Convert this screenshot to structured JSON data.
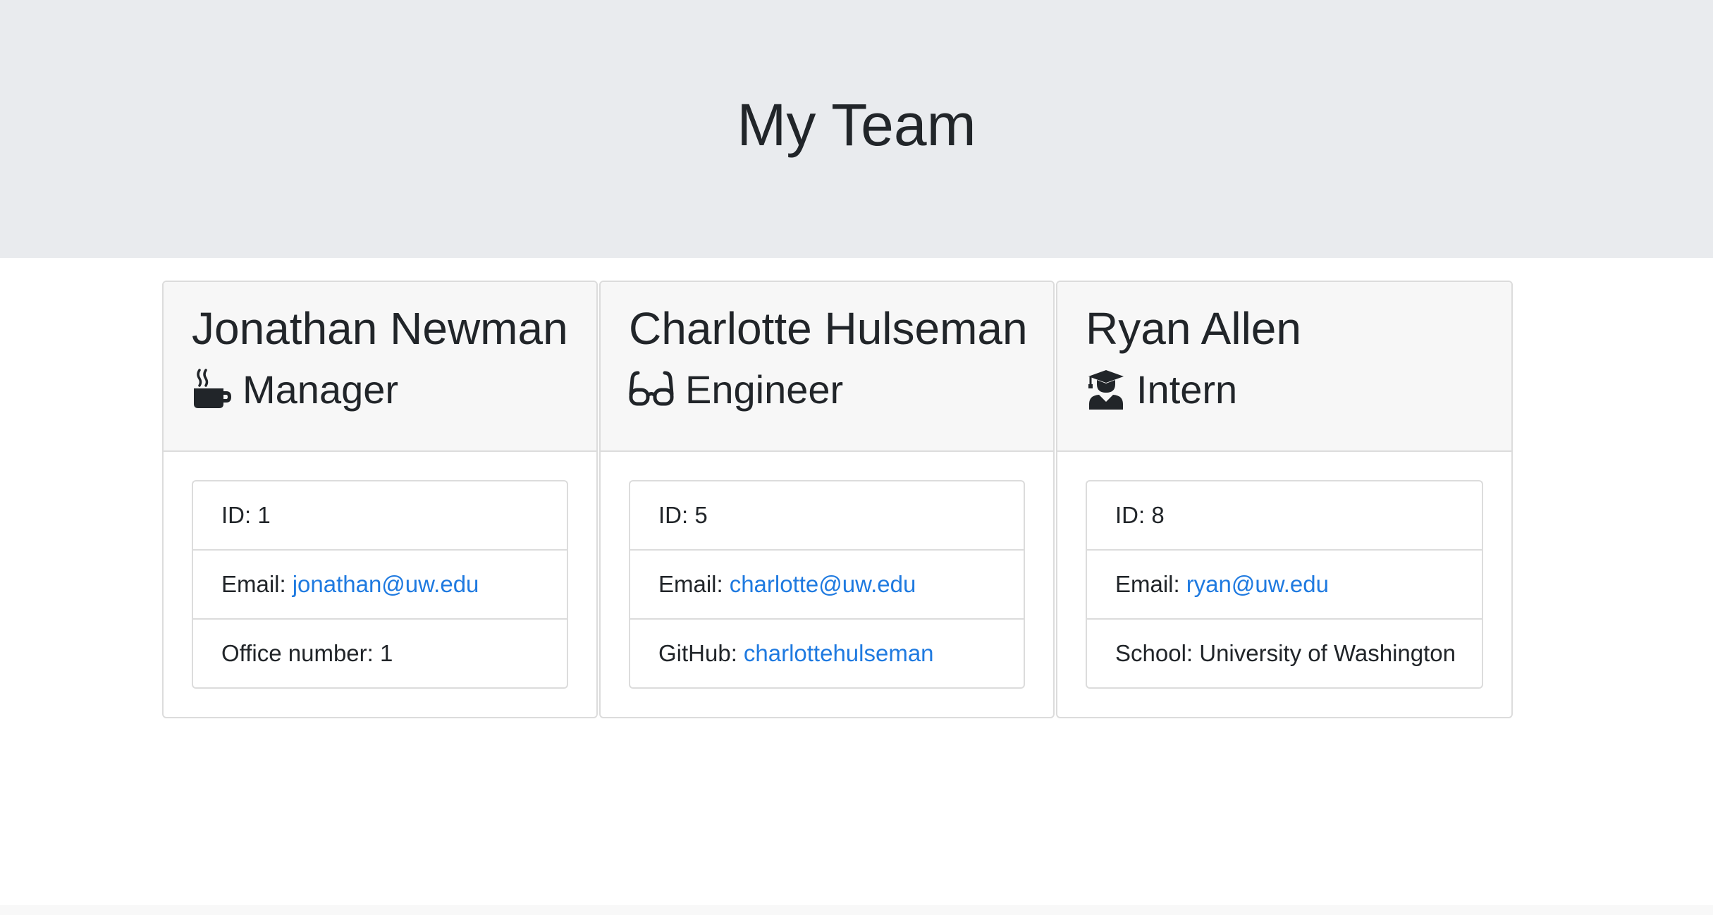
{
  "header": {
    "title": "My Team"
  },
  "employees": [
    {
      "name": "Jonathan Newman",
      "role": "Manager",
      "icon": "coffee-icon",
      "id_label": "ID: 1",
      "email_label": "Email:",
      "email": "jonathan@uw.edu",
      "extra_label": "Office number: 1",
      "extra_link": ""
    },
    {
      "name": "Charlotte Hulseman",
      "role": "Engineer",
      "icon": "glasses-icon",
      "id_label": "ID: 5",
      "email_label": "Email:",
      "email": "charlotte@uw.edu",
      "extra_label": "GitHub:",
      "extra_link": "charlottehulseman"
    },
    {
      "name": "Ryan Allen",
      "role": "Intern",
      "icon": "graduate-icon",
      "id_label": "ID: 8",
      "email_label": "Email:",
      "email": "ryan@uw.edu",
      "extra_label": "School: University of Washington",
      "extra_link": ""
    }
  ],
  "colors": {
    "header_bg": "#e9ebee",
    "card_header_bg": "#f7f7f7",
    "link": "#1f7ae0",
    "text": "#212529"
  }
}
